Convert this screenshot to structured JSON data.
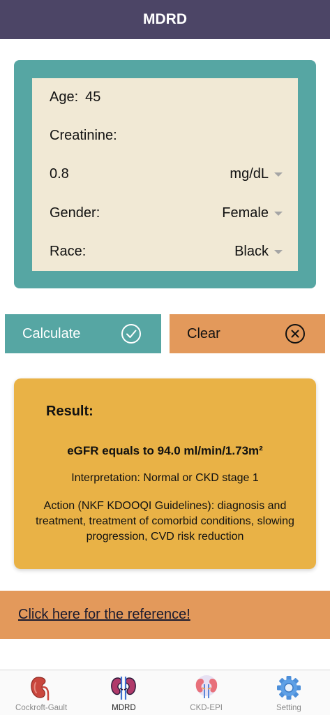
{
  "header": {
    "title": "MDRD"
  },
  "form": {
    "age_label": "Age:",
    "age_value": "45",
    "creatinine_label": "Creatinine:",
    "creatinine_value": "0.8",
    "unit_selected": "mg/dL",
    "gender_label": "Gender:",
    "gender_selected": "Female",
    "race_label": "Race:",
    "race_selected": "Black"
  },
  "buttons": {
    "calculate_label": "Calculate",
    "clear_label": "Clear"
  },
  "result": {
    "heading": "Result:",
    "egfr": "eGFR equals to 94.0 ml/min/1.73m²",
    "interpretation": "Interpretation: Normal or CKD stage 1",
    "action": "Action (NKF KDOOQI Guidelines): diagnosis and treatment, treatment of comorbid conditions, slowing progression, CVD risk reduction"
  },
  "reference": {
    "link_text": "Click here for the reference!"
  },
  "tabs": [
    {
      "label": "Cockroft-Gault",
      "icon": "kidney-icon",
      "active": false
    },
    {
      "label": "MDRD",
      "icon": "kidneys-icon",
      "active": true
    },
    {
      "label": "CKD-EPI",
      "icon": "kidneys-light-icon",
      "active": false
    },
    {
      "label": "Setting",
      "icon": "gear-icon",
      "active": false
    }
  ],
  "colors": {
    "header": "#4c4566",
    "teal": "#56a6a3",
    "cream": "#f1e9d5",
    "orange": "#e3995b",
    "gold": "#e9b246"
  }
}
